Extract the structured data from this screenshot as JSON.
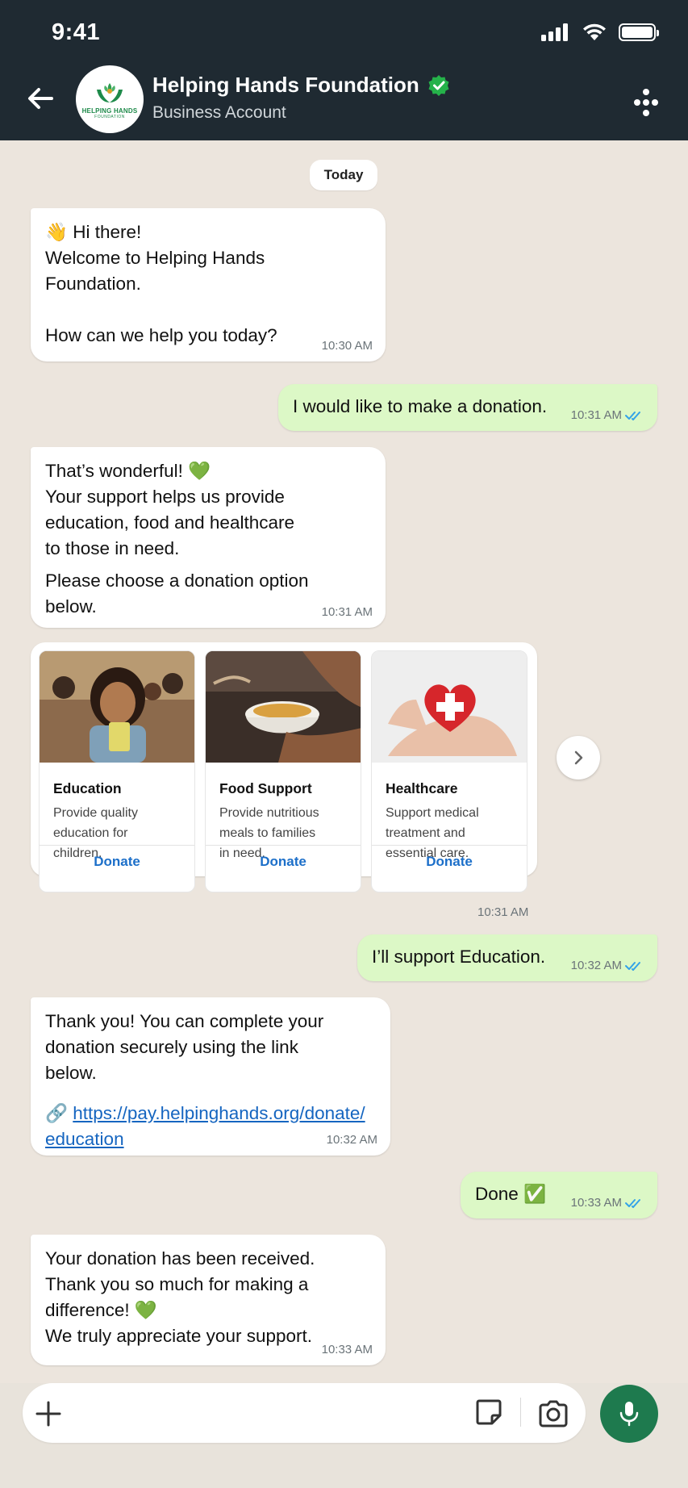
{
  "status_bar": {
    "time": "9:41"
  },
  "header": {
    "title": "Helping Hands Foundation",
    "subtitle": "Business Account",
    "avatar_text": "HELPING HANDS",
    "avatar_subtext": "FOUNDATION",
    "verified_icon": "verified-badge-icon",
    "colors": {
      "bar": "#1f2a32",
      "verified": "#25b24a"
    }
  },
  "chat": {
    "date_label": "Today",
    "messages": [
      {
        "from": "business",
        "lines": [
          "👋 Hi there!",
          "Welcome to Helping Hands",
          "Foundation.",
          "",
          "How can we help you today?"
        ],
        "time": "10:30 AM"
      },
      {
        "from": "user",
        "lines": [
          "I would like to make a donation."
        ],
        "time": "10:31 AM"
      },
      {
        "from": "business",
        "lines": [
          "That’s wonderful! 💚",
          "Your support helps us provide",
          "education, food and healthcare",
          "to those in need.",
          "Please choose a donation option",
          "below."
        ],
        "time": "10:31 AM"
      },
      {
        "from": "user",
        "lines": [
          "I’ll support Education."
        ],
        "time": "10:32 AM"
      },
      {
        "from": "business",
        "lines": [
          "Thank you! You can complete your",
          "donation securely using the link",
          "below."
        ],
        "link_lines": [
          "https://pay.helpinghands.org/donate/",
          "education"
        ],
        "time": "10:32 AM"
      },
      {
        "from": "user",
        "lines": [
          "Done ✅"
        ],
        "time": "10:33 AM"
      },
      {
        "from": "business",
        "lines": [
          "Your donation has been received.",
          "Thank you so much for making a",
          "difference! 💚",
          "We truly appreciate your support."
        ],
        "time": "10:33 AM"
      }
    ],
    "carousel": {
      "time": "10:31 AM",
      "cards": [
        {
          "title": "Education",
          "desc_lines": [
            "Provide quality",
            "education for",
            "children."
          ],
          "button": "Donate"
        },
        {
          "title": "Food Support",
          "desc_lines": [
            "Provide nutritious",
            "meals to families",
            "in need."
          ],
          "button": "Donate"
        },
        {
          "title": "Healthcare",
          "desc_lines": [
            "Support medical",
            "treatment and",
            "essential care."
          ],
          "button": "Donate"
        }
      ]
    }
  },
  "composer": {
    "placeholder": "",
    "colors": {
      "mic": "#1e7a4e"
    }
  }
}
